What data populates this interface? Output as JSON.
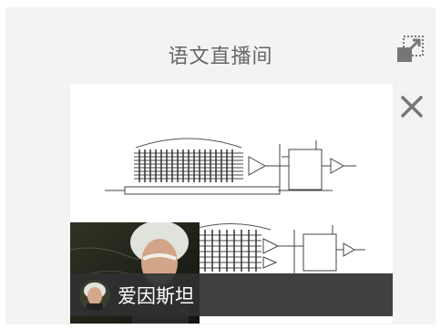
{
  "window": {
    "title": "语文直播间"
  },
  "icons": {
    "popout": "popout-window-icon",
    "close": "close-icon"
  },
  "stream": {
    "teacher_name": "爱因斯坦"
  },
  "colors": {
    "panel_bg": "#f3f3f3",
    "title_text": "#666666",
    "icon": "#777777",
    "name_bar": "#303030"
  }
}
